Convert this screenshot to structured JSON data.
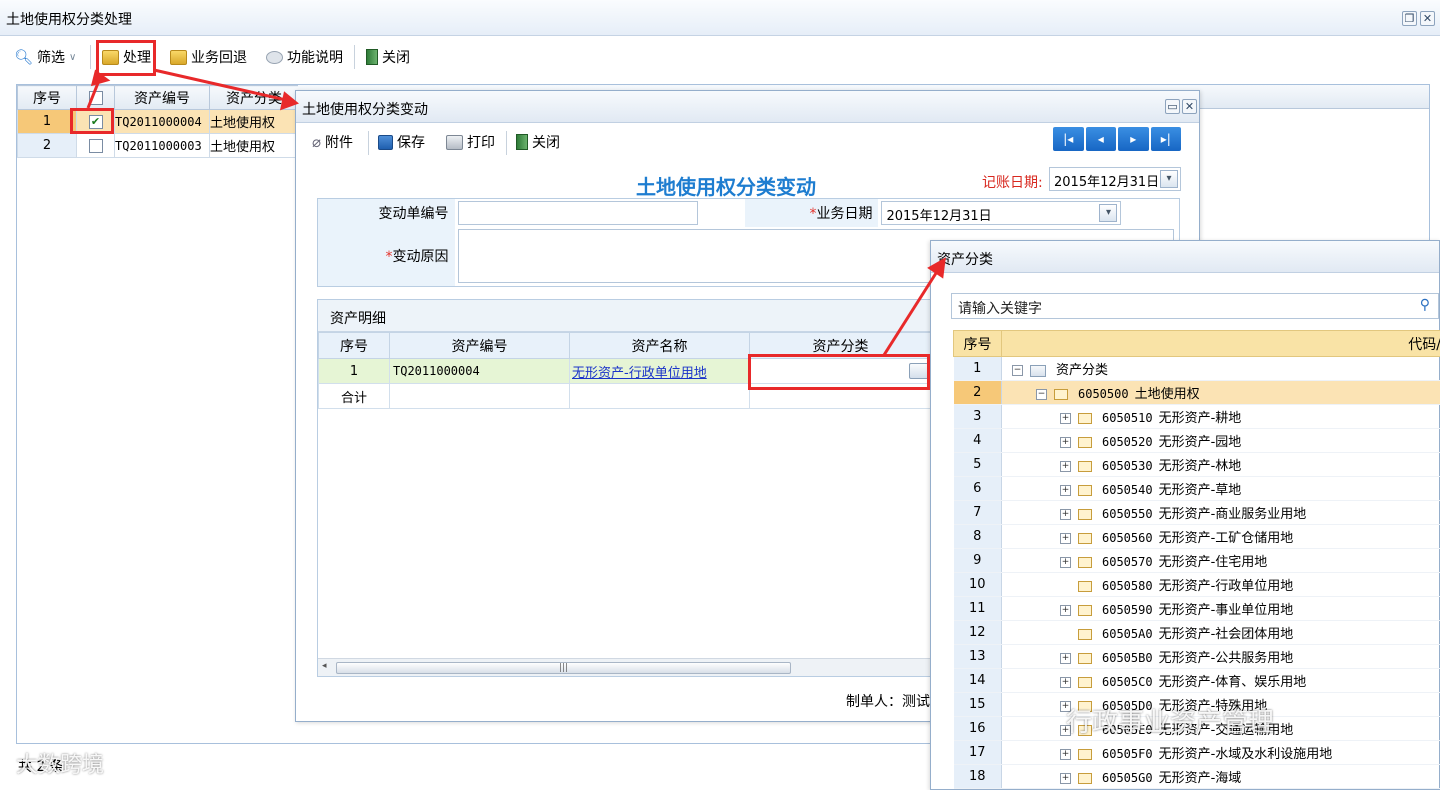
{
  "main_window": {
    "title": "土地使用权分类处理",
    "toolbar": {
      "filter": "筛选",
      "process": "处理",
      "rollback": "业务回退",
      "help": "功能说明",
      "close": "关闭"
    },
    "grid": {
      "columns": [
        "序号",
        "",
        "资产编号",
        "资产分类"
      ],
      "rows": [
        {
          "no": "1",
          "checked": "✔",
          "code": "TQ2011000004",
          "category": "土地使用权"
        },
        {
          "no": "2",
          "checked": "",
          "code": "TQ2011000003",
          "category": "土地使用权"
        }
      ]
    },
    "footer": "共 2 条"
  },
  "change_dialog": {
    "title": "土地使用权分类变动",
    "toolbar": {
      "attach": "附件",
      "save": "保存",
      "print": "打印",
      "close": "关闭"
    },
    "nav": [
      "|◂",
      "◂",
      "▸",
      "▸|"
    ],
    "form_title": "土地使用权分类变动",
    "posting_date_label": "记账日期:",
    "posting_date": "2015年12月31日",
    "fields": {
      "change_no_label": "变动单编号",
      "change_no": "",
      "biz_date_label": "业务日期",
      "biz_date": "2015年12月31日",
      "reason_label": "变动原因",
      "reason": ""
    },
    "detail": {
      "caption": "资产明细",
      "columns": [
        "序号",
        "资产编号",
        "资产名称",
        "资产分类"
      ],
      "rows": [
        {
          "no": "1",
          "code": "TQ2011000004",
          "name": "无形资产-行政单位用地",
          "category": ""
        }
      ],
      "total_label": "合计"
    },
    "maker": "制单人：测试"
  },
  "category_dialog": {
    "title": "资产分类",
    "search_placeholder": "请输入关键字",
    "columns": [
      "序号",
      "代码/"
    ],
    "rows": [
      {
        "no": "1",
        "level": 0,
        "expander": "⊟",
        "code": "",
        "name": "资产分类"
      },
      {
        "no": "2",
        "level": 1,
        "expander": "⊟",
        "code": "6050500",
        "name": "土地使用权"
      },
      {
        "no": "3",
        "level": 2,
        "expander": "⊞",
        "code": "6050510",
        "name": "无形资产-耕地"
      },
      {
        "no": "4",
        "level": 2,
        "expander": "⊞",
        "code": "6050520",
        "name": "无形资产-园地"
      },
      {
        "no": "5",
        "level": 2,
        "expander": "⊞",
        "code": "6050530",
        "name": "无形资产-林地"
      },
      {
        "no": "6",
        "level": 2,
        "expander": "⊞",
        "code": "6050540",
        "name": "无形资产-草地"
      },
      {
        "no": "7",
        "level": 2,
        "expander": "⊞",
        "code": "6050550",
        "name": "无形资产-商业服务业用地"
      },
      {
        "no": "8",
        "level": 2,
        "expander": "⊞",
        "code": "6050560",
        "name": "无形资产-工矿仓储用地"
      },
      {
        "no": "9",
        "level": 2,
        "expander": "⊞",
        "code": "6050570",
        "name": "无形资产-住宅用地"
      },
      {
        "no": "10",
        "level": 2,
        "expander": "",
        "code": "6050580",
        "name": "无形资产-行政单位用地"
      },
      {
        "no": "11",
        "level": 2,
        "expander": "⊞",
        "code": "6050590",
        "name": "无形资产-事业单位用地"
      },
      {
        "no": "12",
        "level": 2,
        "expander": "",
        "code": "60505A0",
        "name": "无形资产-社会团体用地"
      },
      {
        "no": "13",
        "level": 2,
        "expander": "⊞",
        "code": "60505B0",
        "name": "无形资产-公共服务用地"
      },
      {
        "no": "14",
        "level": 2,
        "expander": "⊞",
        "code": "60505C0",
        "name": "无形资产-体育、娱乐用地"
      },
      {
        "no": "15",
        "level": 2,
        "expander": "⊞",
        "code": "60505D0",
        "name": "无形资产-特殊用地"
      },
      {
        "no": "16",
        "level": 2,
        "expander": "⊞",
        "code": "60505E0",
        "name": "无形资产-交通运输用地"
      },
      {
        "no": "17",
        "level": 2,
        "expander": "⊞",
        "code": "60505F0",
        "name": "无形资产-水域及水利设施用地"
      },
      {
        "no": "18",
        "level": 2,
        "expander": "⊞",
        "code": "60505G0",
        "name": "无形资产-海域"
      }
    ],
    "selected_row": "2"
  },
  "watermarks": [
    "行政事业资产管理",
    "大数跨境"
  ],
  "colors": {
    "highlight": "#e8292a",
    "accent": "#1e7dd0",
    "selected_row": "#fbe3b4"
  }
}
